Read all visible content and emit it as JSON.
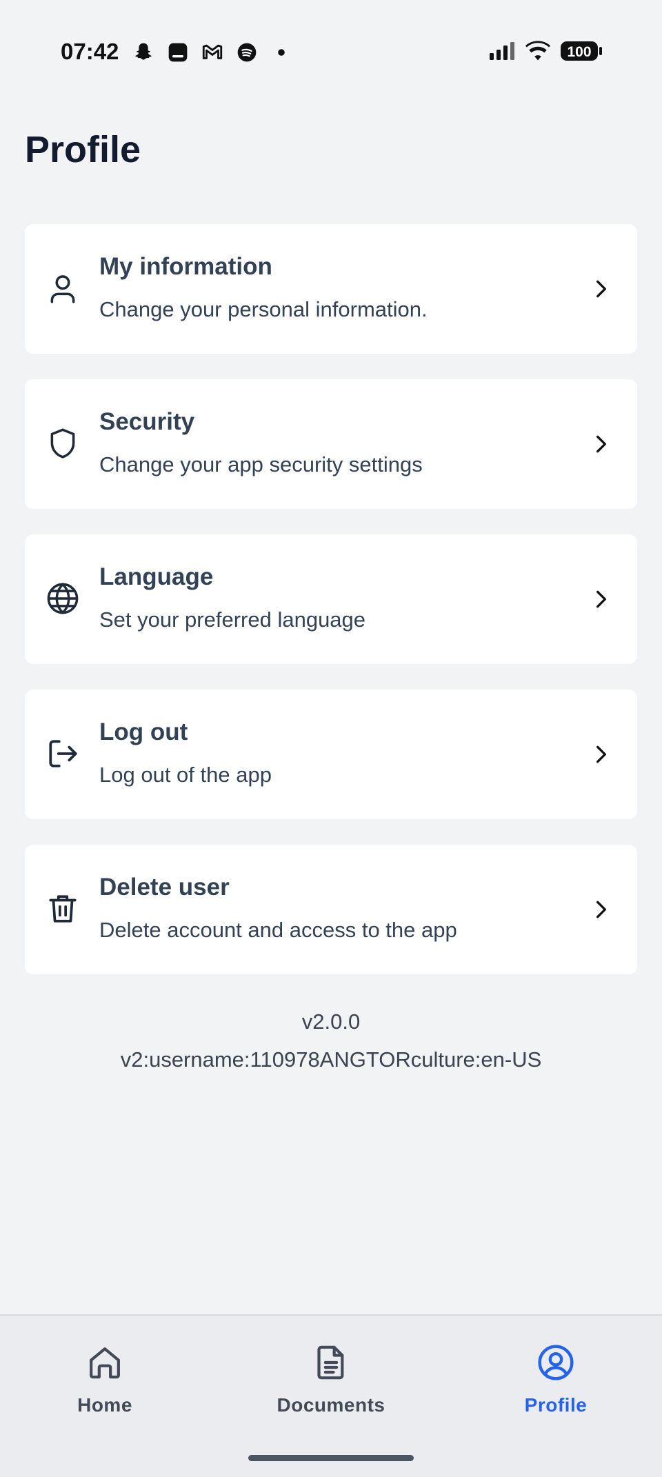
{
  "status_bar": {
    "time": "07:42",
    "battery": "100",
    "left_icons": [
      "snapchat-icon",
      "app-icon",
      "gmail-icon",
      "spotify-icon",
      "dot-icon"
    ],
    "right_icons": [
      "signal-icon",
      "wifi-icon",
      "battery-icon"
    ]
  },
  "page": {
    "title": "Profile"
  },
  "menu": [
    {
      "id": "my-information",
      "icon": "person-icon",
      "title": "My information",
      "subtitle": "Change your personal information."
    },
    {
      "id": "security",
      "icon": "shield-icon",
      "title": "Security",
      "subtitle": "Change your app security settings"
    },
    {
      "id": "language",
      "icon": "globe-icon",
      "title": "Language",
      "subtitle": "Set your preferred language"
    },
    {
      "id": "log-out",
      "icon": "logout-icon",
      "title": "Log out",
      "subtitle": "Log out of the app"
    },
    {
      "id": "delete-user",
      "icon": "trash-icon",
      "title": "Delete user",
      "subtitle": "Delete account and access to the app"
    }
  ],
  "footer": {
    "version": "v2.0.0",
    "build_info": "v2:username:110978ANGTORculture:en-US"
  },
  "bottom_nav": [
    {
      "label": "Home",
      "icon": "home-icon",
      "active": false
    },
    {
      "label": "Documents",
      "icon": "document-icon",
      "active": false
    },
    {
      "label": "Profile",
      "icon": "profile-circle-icon",
      "active": true
    }
  ],
  "colors": {
    "background": "#f2f3f5",
    "card": "#ffffff",
    "text": "#334155",
    "accent": "#2563eb",
    "nav_background": "#ebecef"
  }
}
